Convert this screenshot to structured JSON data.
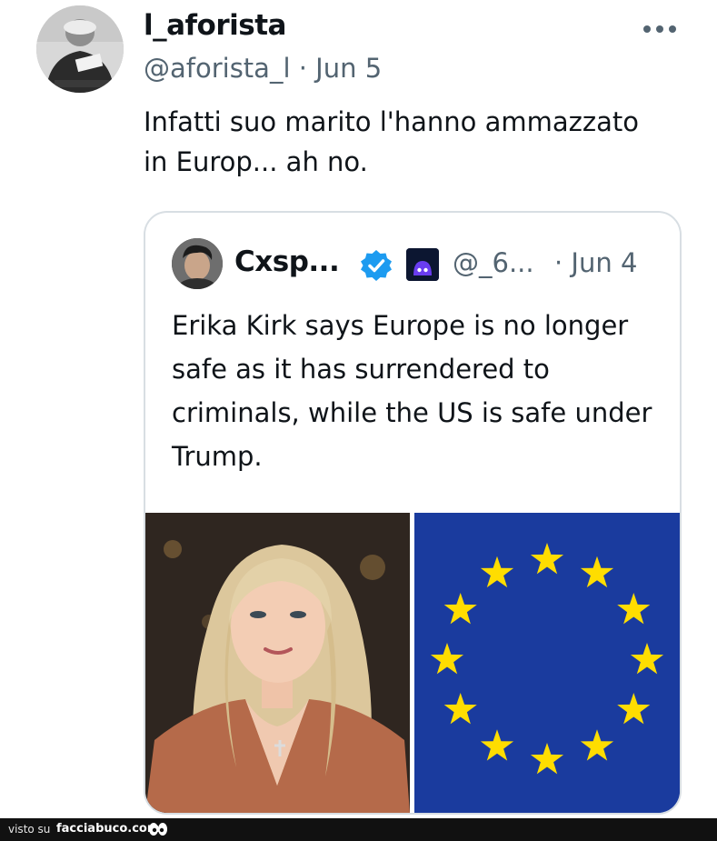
{
  "tweet": {
    "display_name": "l_aforista",
    "handle": "@aforista_l",
    "separator": "·",
    "date": "Jun 5",
    "more_icon": "more-options-icon",
    "text": "Infatti suo marito l'hanno ammazzato in Europ... ah no."
  },
  "quote": {
    "display_name": "Cxsp...",
    "verified_icon": "verified-badge-icon",
    "bot_icon": "bot-badge-icon",
    "handle": "@_6...",
    "date": "· Jun 4",
    "text": "Erika Kirk says Europe is no longer safe as it has surrendered to criminals, while the US is safe under Trump.",
    "images": [
      "photo-woman",
      "eu-flag"
    ],
    "colors": {
      "eu_blue": "#1a3b9e",
      "eu_star": "#ffdd00",
      "verified": "#1d9bf0"
    }
  },
  "footer": {
    "visto_label": "visto su",
    "site": "facciabuco.com"
  }
}
